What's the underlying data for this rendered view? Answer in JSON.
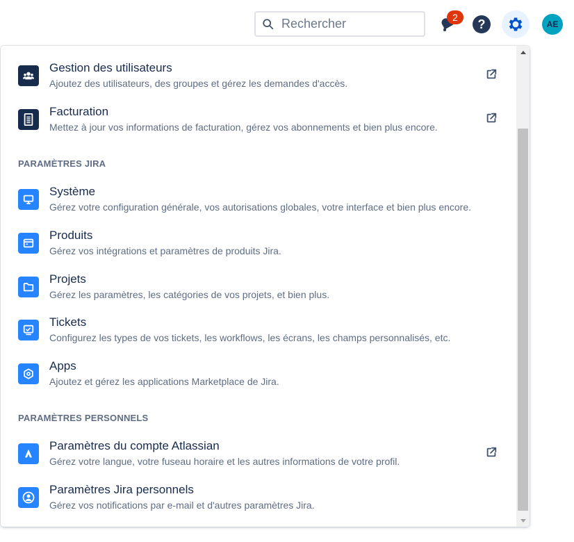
{
  "header": {
    "search_placeholder": "Rechercher",
    "notification_count": "2",
    "help_symbol": "?",
    "avatar_initials": "AE"
  },
  "menu": {
    "admin_items": [
      {
        "title": "Gestion des utilisateurs",
        "desc": "Ajoutez des utilisateurs, des groupes et gérez les demandes d'accès.",
        "icon": "users-icon",
        "external": true
      },
      {
        "title": "Facturation",
        "desc": "Mettez à jour vos informations de facturation, gérez vos abonnements et bien plus encore.",
        "icon": "billing-icon",
        "external": true
      }
    ],
    "jira_section_title": "PARAMÈTRES JIRA",
    "jira_items": [
      {
        "title": "Système",
        "desc": "Gérez votre configuration générale, vos autorisations globales, votre interface et bien plus encore.",
        "icon": "monitor-icon"
      },
      {
        "title": "Produits",
        "desc": "Gérez vos intégrations et paramètres de produits Jira.",
        "icon": "product-icon"
      },
      {
        "title": "Projets",
        "desc": "Gérez les paramètres, les catégories de vos projets, et bien plus.",
        "icon": "folder-icon"
      },
      {
        "title": "Tickets",
        "desc": "Configurez les types de vos tickets, les workflows, les écrans, les champs personnalisés, etc.",
        "icon": "ticket-icon"
      },
      {
        "title": "Apps",
        "desc": "Ajoutez et gérez les applications Marketplace de Jira.",
        "icon": "apps-icon"
      }
    ],
    "personal_section_title": "PARAMÈTRES PERSONNELS",
    "personal_items": [
      {
        "title": "Paramètres du compte Atlassian",
        "desc": "Gérez votre langue, votre fuseau horaire et les autres informations de votre profil.",
        "icon": "atlassian-icon",
        "external": true
      },
      {
        "title": "Paramètres Jira personnels",
        "desc": "Gérez vos notifications par e-mail et d'autres paramètres Jira.",
        "icon": "person-icon"
      }
    ]
  },
  "colors": {
    "accent": "#0052cc",
    "icon_blue": "#2684ff",
    "icon_dark": "#172b4d",
    "badge": "#de350b"
  }
}
